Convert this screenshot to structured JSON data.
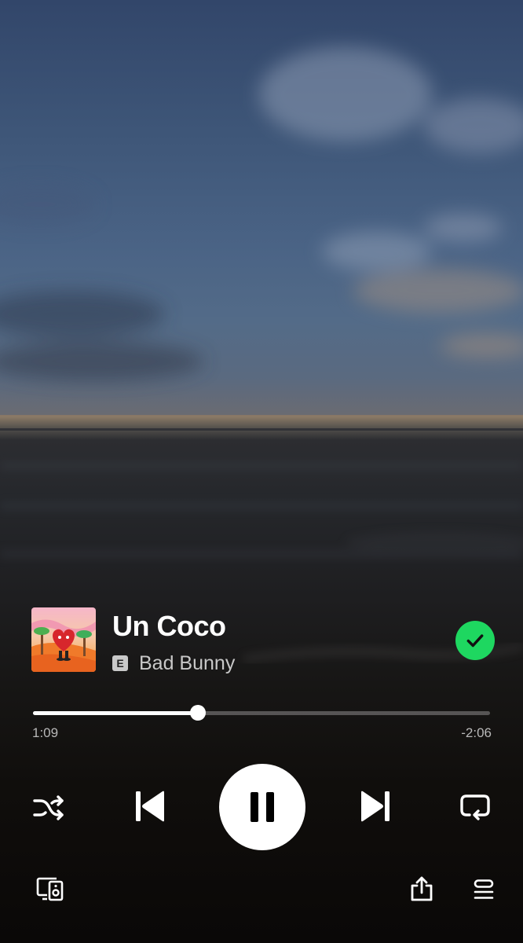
{
  "track": {
    "title": "Un Coco",
    "artist": "Bad Bunny",
    "explicit_badge": "E",
    "liked": true
  },
  "playback": {
    "elapsed": "1:09",
    "remaining": "-2:06",
    "progress": 0.36,
    "state": "playing"
  },
  "controls": {
    "shuffle_icon": "shuffle-icon",
    "previous_icon": "skip-previous-icon",
    "pause_icon": "pause-icon",
    "next_icon": "skip-next-icon",
    "repeat_icon": "repeat-icon",
    "devices_icon": "connect-device-icon",
    "share_icon": "share-icon",
    "queue_icon": "queue-icon"
  },
  "colors": {
    "liked_green": "#1ed760",
    "control_white": "#ffffff"
  }
}
